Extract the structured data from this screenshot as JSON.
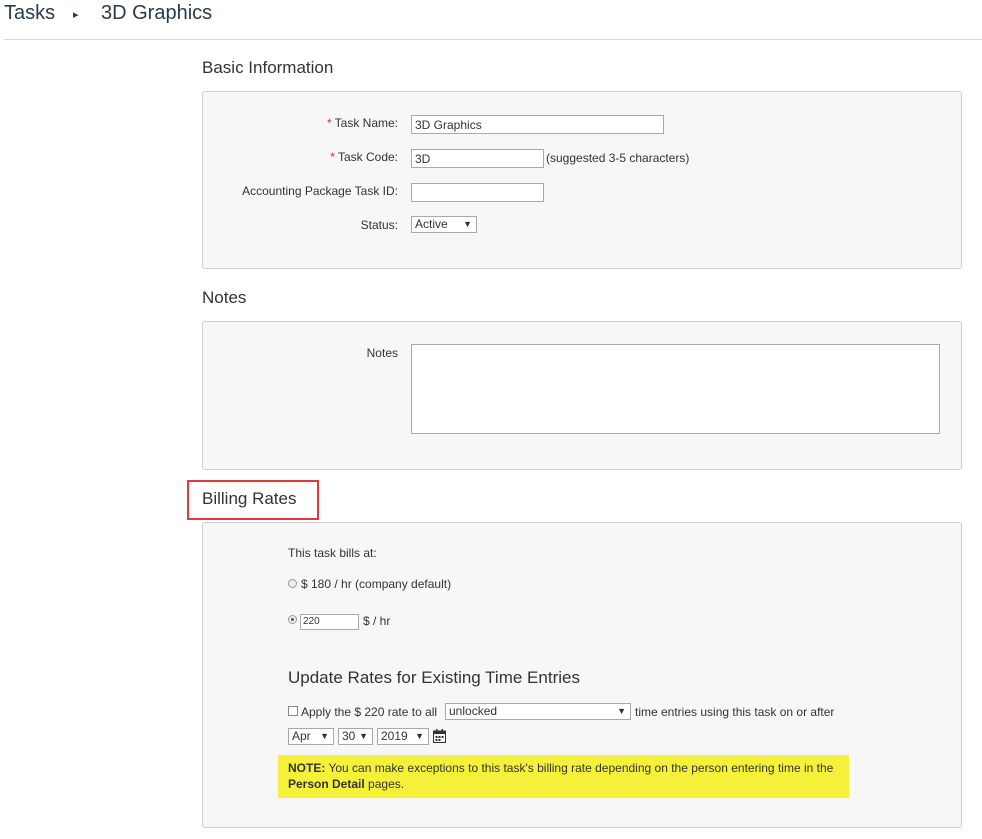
{
  "breadcrumb": {
    "root": "Tasks",
    "separator": "▸",
    "current": "3D Graphics"
  },
  "basic": {
    "title": "Basic Information",
    "task_name_label": "Task Name:",
    "task_name_value": "3D Graphics",
    "task_code_label": "Task Code:",
    "task_code_value": "3D",
    "task_code_hint": "(suggested 3-5 characters)",
    "accounting_label": "Accounting Package Task ID:",
    "accounting_value": "",
    "status_label": "Status:",
    "status_value": "Active",
    "required_marker": "*"
  },
  "notes": {
    "title": "Notes",
    "label": "Notes",
    "value": ""
  },
  "billing": {
    "title": "Billing Rates",
    "bills_at": "This task bills at:",
    "default_option": "$ 180 / hr (company default)",
    "custom_value": "220",
    "custom_unit": "$ / hr",
    "default_selected": false,
    "custom_selected": true
  },
  "update": {
    "title": "Update Rates for Existing Time Entries",
    "apply_text": "Apply the $ 220 rate to all",
    "entries_select": "unlocked",
    "after_text": "time entries using this task on or after",
    "month": "Apr",
    "day": "30",
    "year": "2019",
    "apply_checked": false
  },
  "note": {
    "prefix": "NOTE:",
    "text": "You can make exceptions to this task's billing rate depending on the person entering time in the",
    "link": "Person Detail",
    "suffix": "pages."
  },
  "colors": {
    "note_bg": "#f5f13a",
    "highlight": "#e0393e",
    "required": "#c0392b"
  }
}
